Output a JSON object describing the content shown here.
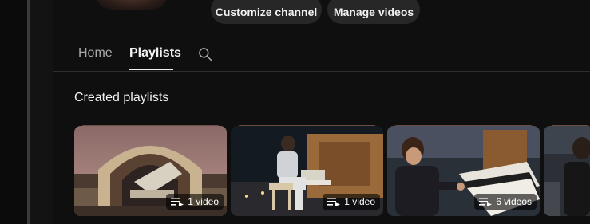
{
  "header": {
    "customize_label": "Customize channel",
    "manage_label": "Manage videos"
  },
  "tabs": [
    {
      "label": "Home",
      "selected": false
    },
    {
      "label": "Playlists",
      "selected": true
    }
  ],
  "section": {
    "title": "Created playlists"
  },
  "playlists": [
    {
      "count_label": "1 video",
      "thumb": "ornate-organ-pavilion"
    },
    {
      "count_label": "1 video",
      "thumb": "organist-at-night"
    },
    {
      "count_label": "6 videos",
      "thumb": "organist-smiling"
    },
    {
      "count_label": "",
      "thumb": "partial-card"
    }
  ],
  "icons": {
    "search": "search-icon",
    "playlist": "playlist-icon"
  },
  "colors": {
    "background": "#0f0f0f",
    "button": "#272727",
    "text": "#f1f1f1",
    "muted": "#aaaaaa"
  }
}
